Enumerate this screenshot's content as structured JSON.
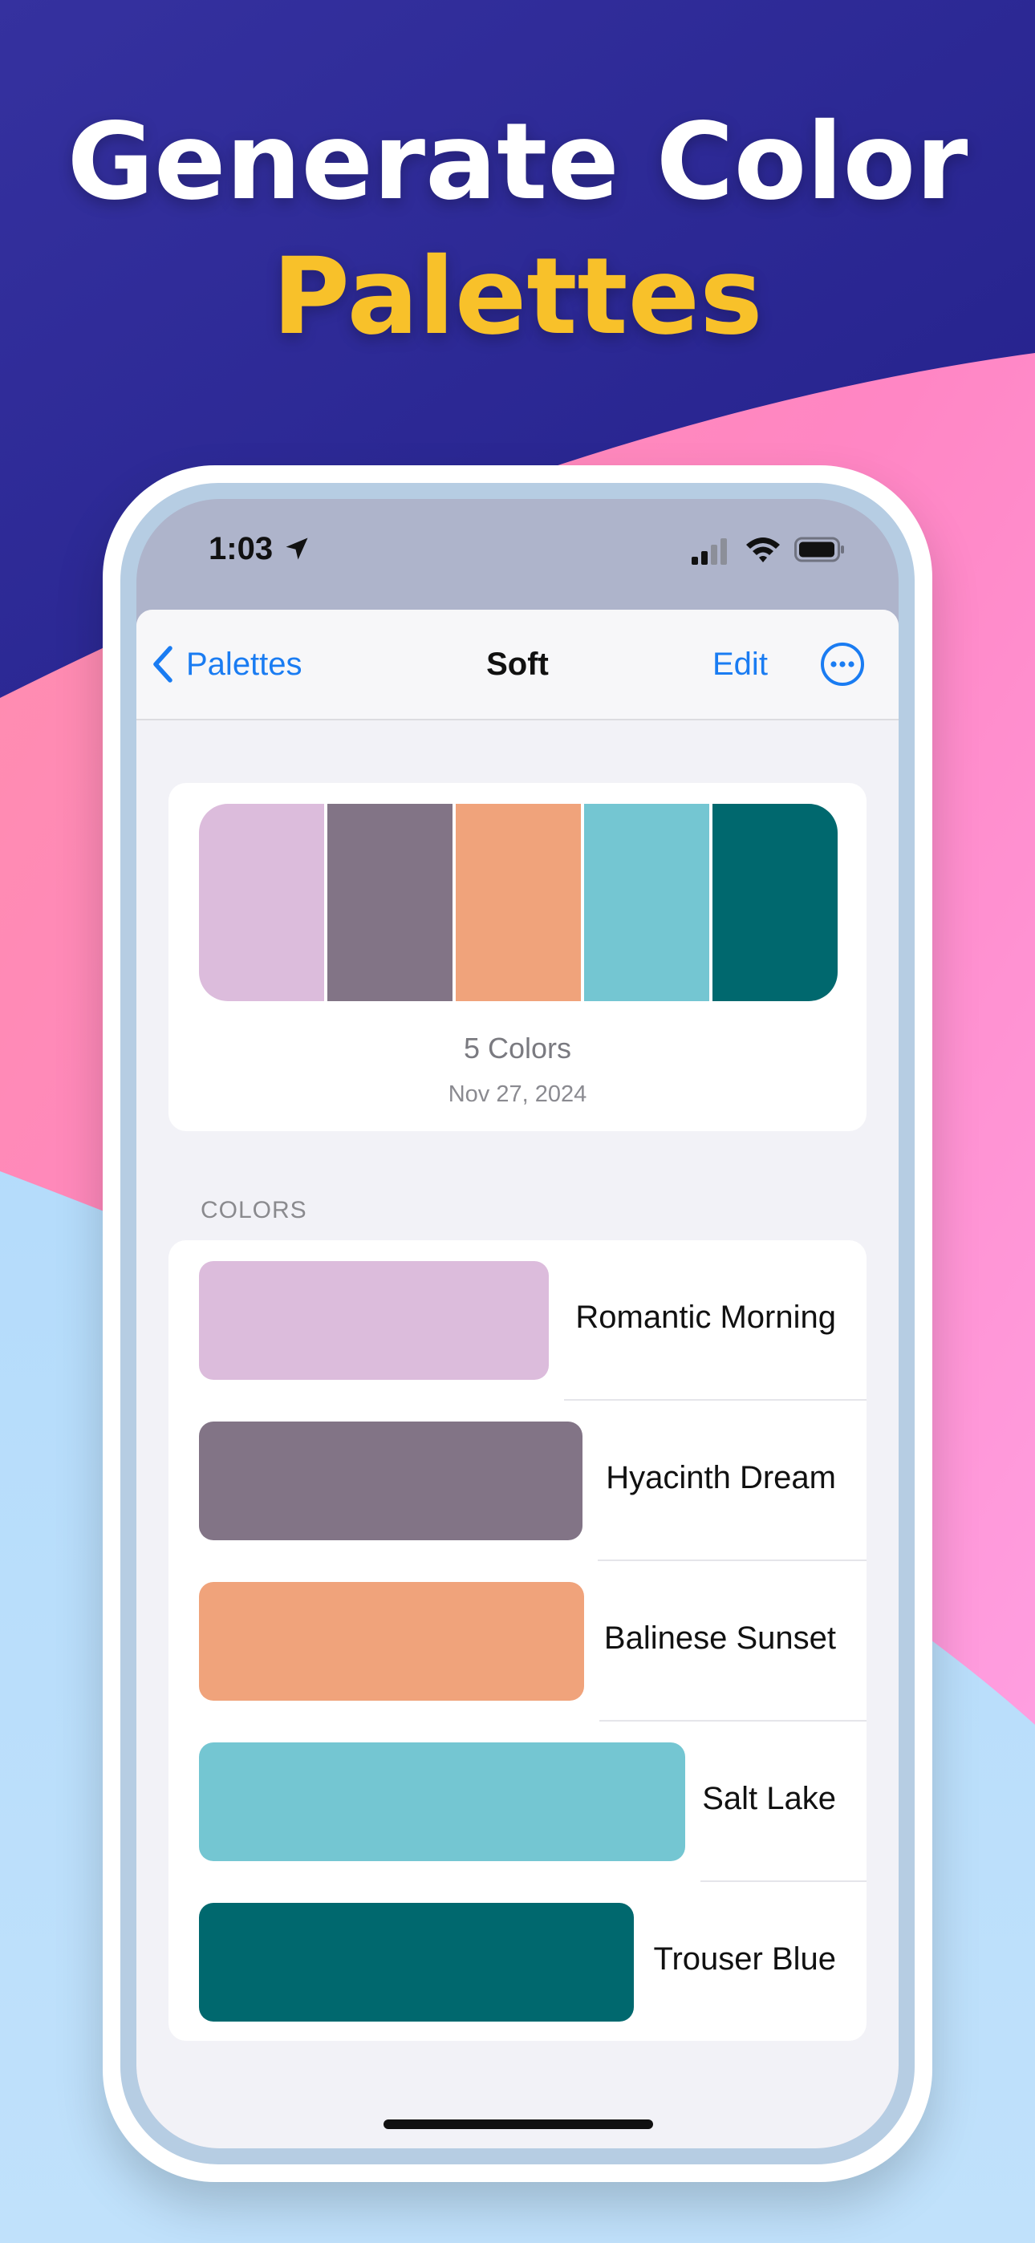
{
  "headline": {
    "line1": "Generate Color",
    "line2": "Palettes",
    "line2_color": "#f8c12a"
  },
  "status_bar": {
    "time": "1:03"
  },
  "navbar": {
    "back_label": "Palettes",
    "title": "Soft",
    "edit_label": "Edit"
  },
  "palette": {
    "count_label": "5 Colors",
    "date": "Nov 27, 2024",
    "swatches": [
      "#dcbcdc",
      "#827486",
      "#f0a37b",
      "#74c6d2",
      "#00686e"
    ]
  },
  "colors_section": {
    "header": "COLORS",
    "items": [
      {
        "name": "Romantic Morning",
        "hex": "#dcbcdc"
      },
      {
        "name": "Hyacinth Dream",
        "hex": "#827486"
      },
      {
        "name": "Balinese Sunset",
        "hex": "#f0a37b"
      },
      {
        "name": "Salt Lake",
        "hex": "#74c6d2"
      },
      {
        "name": "Trouser Blue",
        "hex": "#00686e"
      }
    ]
  },
  "theme": {
    "accent": "#1a7cf2",
    "background_top": "#2e2a98",
    "background_middle": "#ff86c4",
    "background_bottom": "#b7dcf9"
  }
}
